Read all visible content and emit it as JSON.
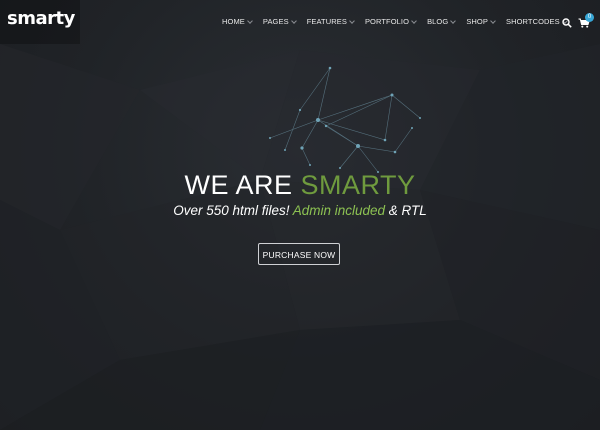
{
  "brand": {
    "logo_text": "smarty",
    "accent_color": "#6f9b3e",
    "accent_light_color": "#8cc152",
    "badge_color": "#37a6d6"
  },
  "nav": {
    "items": [
      {
        "label": "HOME"
      },
      {
        "label": "PAGES"
      },
      {
        "label": "FEATURES"
      },
      {
        "label": "PORTFOLIO"
      },
      {
        "label": "BLOG"
      },
      {
        "label": "SHOP"
      },
      {
        "label": "SHORTCODES"
      }
    ],
    "search_icon": "search-icon",
    "cart_icon": "cart-icon",
    "cart_count": "0"
  },
  "hero": {
    "title_prefix": "WE ARE ",
    "title_accent": "SMARTY",
    "subtitle_prefix": "Over 550 html files! ",
    "subtitle_accent": "Admin included",
    "subtitle_suffix": " & RTL",
    "cta_label": "PURCHASE NOW"
  }
}
